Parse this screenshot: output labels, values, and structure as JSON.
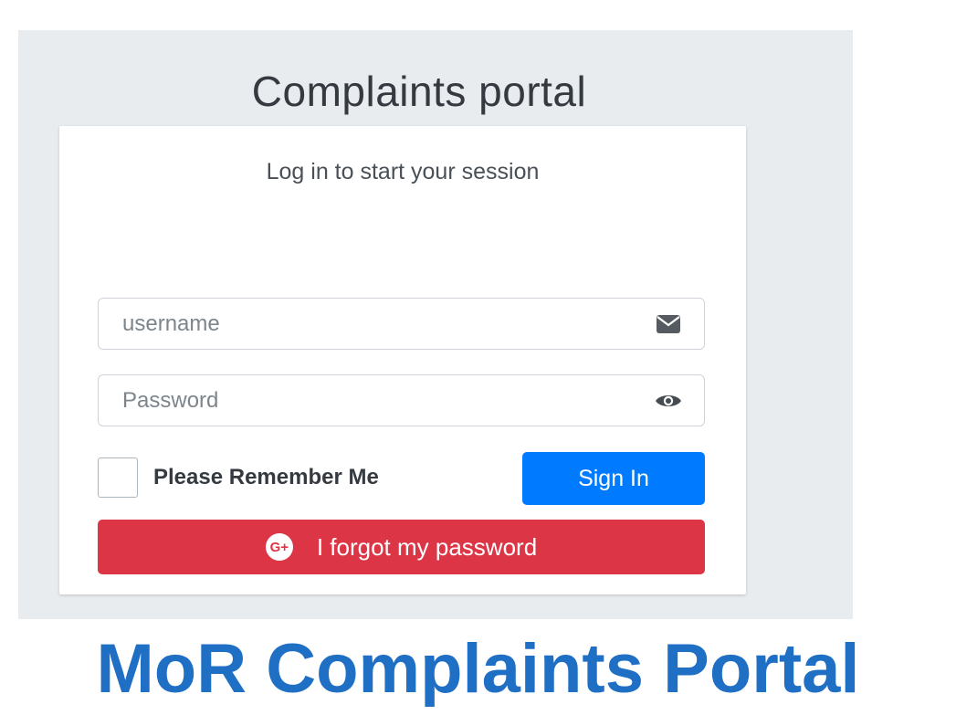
{
  "portal": {
    "title": "Complaints portal"
  },
  "login": {
    "subtitle": "Log in to start your session",
    "username": {
      "placeholder": "username",
      "value": "",
      "icon": "envelope-icon"
    },
    "password": {
      "placeholder": "Password",
      "value": "",
      "icon": "eye-icon"
    },
    "remember_label": "Please Remember Me",
    "remember_checked": false,
    "signin_label": "Sign In",
    "forgot_label": "I forgot my password",
    "forgot_icon": "google-plus-icon",
    "forgot_icon_glyph": "G+"
  },
  "banner": {
    "title": "MoR Complaints Portal"
  },
  "colors": {
    "page_bg": "#e9ecef",
    "primary": "#007bff",
    "danger": "#dc3545",
    "banner": "#1f6fc5"
  }
}
